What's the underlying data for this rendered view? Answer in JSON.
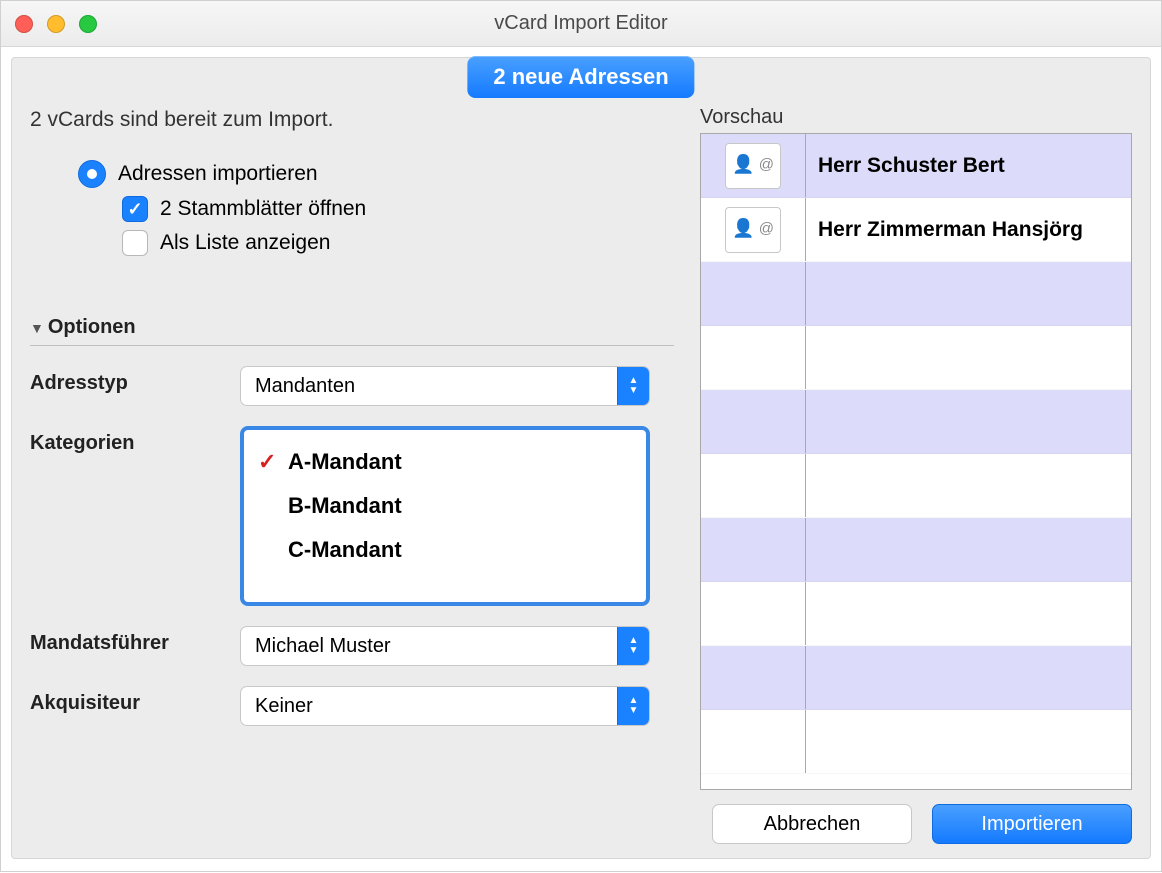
{
  "window": {
    "title": "vCard Import Editor"
  },
  "banner": {
    "text": "2 neue Adressen"
  },
  "status": "2 vCards sind bereit zum Import.",
  "import": {
    "radio_label": "Adressen importieren",
    "check_stamm": {
      "label": "2 Stammblätter öffnen",
      "checked": true
    },
    "check_list": {
      "label": "Als Liste anzeigen",
      "checked": false
    }
  },
  "options": {
    "heading": "Optionen",
    "adresstyp": {
      "label": "Adresstyp",
      "value": "Mandanten"
    },
    "kategorien": {
      "label": "Kategorien",
      "items": [
        {
          "label": "A-Mandant",
          "selected": true
        },
        {
          "label": "B-Mandant",
          "selected": false
        },
        {
          "label": "C-Mandant",
          "selected": false
        }
      ]
    },
    "mandatsfuehrer": {
      "label": "Mandatsführer",
      "value": "Michael Muster"
    },
    "akquisiteur": {
      "label": "Akquisiteur",
      "value": "Keiner"
    }
  },
  "preview": {
    "label": "Vorschau",
    "rows": [
      {
        "name": "Herr Schuster Bert"
      },
      {
        "name": "Herr Zimmerman Hansjörg"
      }
    ]
  },
  "buttons": {
    "cancel": "Abbrechen",
    "import": "Importieren"
  }
}
